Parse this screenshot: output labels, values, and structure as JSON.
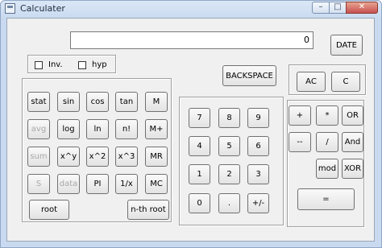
{
  "window": {
    "title": "Calculater",
    "controls": {
      "minimize": "–",
      "maximize": "□",
      "close": "✕"
    }
  },
  "display": {
    "value": "0"
  },
  "checkboxes": {
    "inv": "Inv.",
    "hyp": "hyp"
  },
  "buttons": {
    "date": "DATE",
    "backspace": "BACKSPACE",
    "ac": "AC",
    "c": "C",
    "sci": [
      "stat",
      "sin",
      "cos",
      "tan",
      "M",
      "avg",
      "log",
      "ln",
      "n!",
      "M+",
      "sum",
      "x^y",
      "x^2",
      "x^3",
      "MR",
      "S",
      "data",
      "PI",
      "1/x",
      "MC"
    ],
    "root": "root",
    "nth_root": "n-th root",
    "digits": [
      "7",
      "8",
      "9",
      "4",
      "5",
      "6",
      "1",
      "2",
      "3",
      "0",
      ".",
      "+/-"
    ],
    "ops": {
      "plus": "+",
      "times": "*",
      "or": "OR",
      "minus": "--",
      "divide": "/",
      "and": "And",
      "mod": "mod",
      "xor": "XOR",
      "equals": "="
    }
  }
}
